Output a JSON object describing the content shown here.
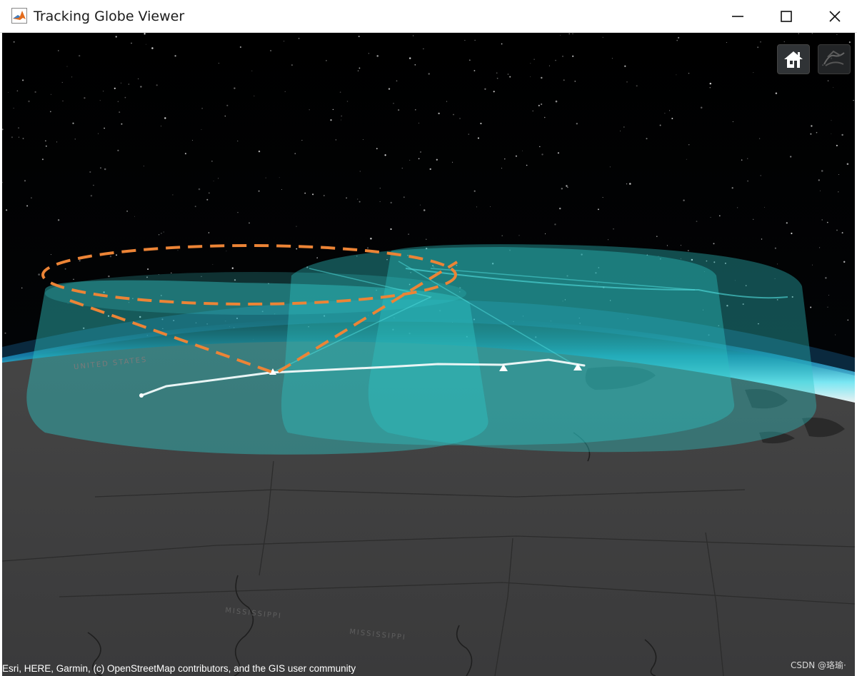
{
  "window": {
    "title": "Tracking Globe Viewer",
    "icon": "matlab-icon",
    "controls": [
      "minimize-icon",
      "maximize-icon",
      "close-icon"
    ]
  },
  "viewer": {
    "home_button_icon": "home-icon",
    "view_mode_button_icon": "globe-view-icon",
    "map_labels": [
      "MISSISSIPPI",
      "MISSISSIPPI"
    ],
    "attribution": "Esri, HERE, Garmin, (c) OpenStreetMap contributors, and the GIS user community",
    "watermark": "CSDN @珞瑜·",
    "colors": {
      "space": "#000000",
      "terrain": "#3e3e3f",
      "atmosphere": "#4fe0ff",
      "coverage": "#2ec4c4",
      "annotation": "#ec8436",
      "track": "#e9f5f5"
    }
  }
}
